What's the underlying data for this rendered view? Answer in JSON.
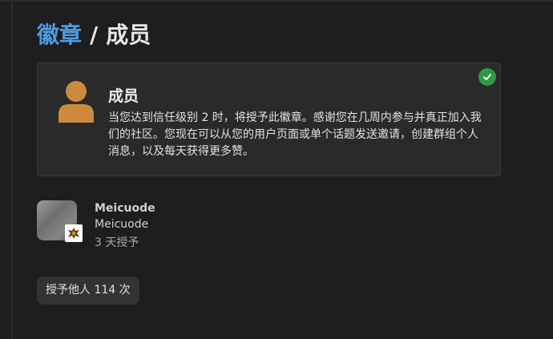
{
  "breadcrumb": {
    "parent": "徽章",
    "separator": "/",
    "current": "成员"
  },
  "badge": {
    "title": "成员",
    "description": "当您达到信任级别 2 时，将授予此徽章。感谢您在几周内参与并真正加入我们的社区。您现在可以从您的用户页面或单个话题发送邀请，创建群组个人消息，以及每天获得更多赞。",
    "icon": "user-icon",
    "icon_color": "#cd8a3e",
    "granted_status_icon": "check-icon",
    "granted_status_color": "#2e9a47"
  },
  "grantee": {
    "username": "Meicuode",
    "name": "Meicuode",
    "granted_ago": "3 天授予"
  },
  "granted_count": "授予他人 114 次",
  "colors": {
    "link": "#4f9be0",
    "background": "#1e1e1e",
    "card": "#2a2a2a"
  }
}
